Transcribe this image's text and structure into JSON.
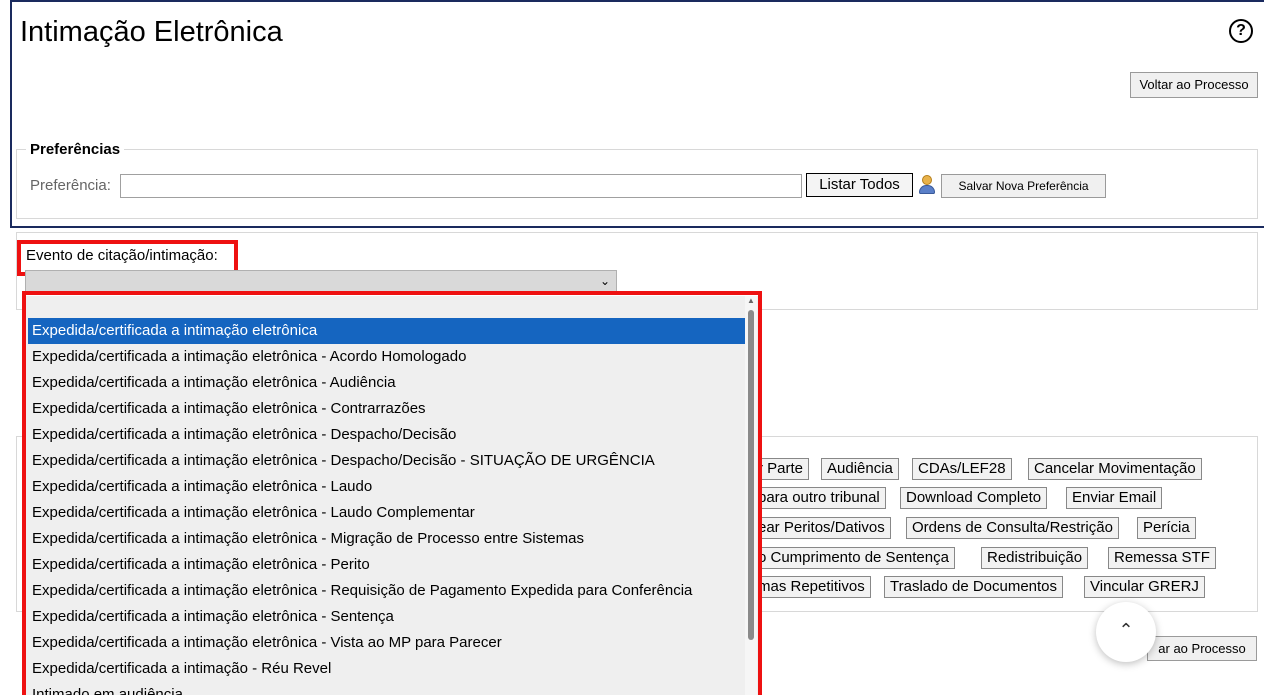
{
  "header": {
    "title": "Intimação Eletrônica",
    "help_icon": "help-circle-icon"
  },
  "voltar_top": {
    "label": "Voltar ao Processo"
  },
  "preferencias": {
    "legend": "Preferências",
    "label": "Preferência:",
    "input_value": "",
    "listar_label": "Listar Todos",
    "user_icon": "user-icon",
    "salvar_label": "Salvar Nova Preferência"
  },
  "evento": {
    "label": "Evento de citação/intimação:",
    "selected_value": ""
  },
  "dropdown": {
    "options": [
      "Expedida/certificada a intimação eletrônica",
      "Expedida/certificada a intimação eletrônica - Acordo Homologado",
      "Expedida/certificada a intimação eletrônica - Audiência",
      "Expedida/certificada a intimação eletrônica - Contrarrazões",
      "Expedida/certificada a intimação eletrônica - Despacho/Decisão",
      "Expedida/certificada a intimação eletrônica - Despacho/Decisão - SITUAÇÃO DE URGÊNCIA",
      "Expedida/certificada a intimação eletrônica - Laudo",
      "Expedida/certificada a intimação eletrônica - Laudo Complementar",
      "Expedida/certificada a intimação eletrônica - Migração de Processo entre Sistemas",
      "Expedida/certificada a intimação eletrônica - Perito",
      "Expedida/certificada a intimação eletrônica - Requisição de Pagamento Expedida para Conferência",
      "Expedida/certificada a intimação eletrônica - Sentença",
      "Expedida/certificada a intimação eletrônica - Vista ao MP para Parecer",
      "Expedida/certificada a intimação - Réu Revel",
      "Intimado em audiência"
    ],
    "selected_index": 0
  },
  "actions": {
    "row1": [
      "r Parte",
      "Audiência",
      "CDAs/LEF28",
      "Cancelar Movimentação"
    ],
    "row2": [
      "para outro tribunal",
      "Download Completo",
      "Enviar Email"
    ],
    "row3": [
      "ear Peritos/Dativos",
      "Ordens de Consulta/Restrição",
      "Perícia"
    ],
    "row4": [
      "o Cumprimento de Sentença",
      "Redistribuição",
      "Remessa STF"
    ],
    "row5": [
      "mas Repetitivos",
      "Traslado de Documentos",
      "Vincular GRERJ"
    ]
  },
  "voltar_bottom": {
    "label": "ar ao Processo"
  },
  "scroll_top": {
    "icon": "chevron-up-icon"
  }
}
